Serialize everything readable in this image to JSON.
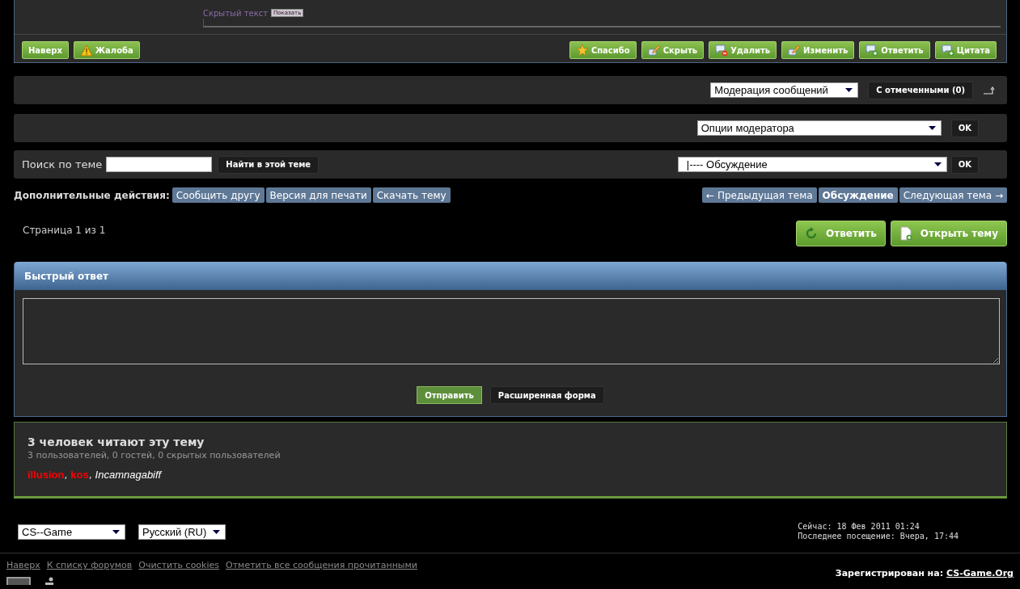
{
  "post": {
    "hidden_text": "Скрытый текст",
    "show_button": "Показать",
    "left_buttons": [
      {
        "label": "Наверх",
        "kind": "plain"
      },
      {
        "label": "Жалоба",
        "kind": "warning"
      }
    ],
    "right_buttons": [
      {
        "label": "Спасибо",
        "kind": "star"
      },
      {
        "label": "Скрыть",
        "kind": "pencil"
      },
      {
        "label": "Удалить",
        "kind": "remove"
      },
      {
        "label": "Изменить",
        "kind": "pencil"
      },
      {
        "label": "Ответить",
        "kind": "add"
      },
      {
        "label": "Цитата",
        "kind": "add"
      }
    ]
  },
  "moderation": {
    "select": "Модерация сообщений",
    "button": "С отмеченными (0)"
  },
  "mod_options": {
    "select": "Опции модератора",
    "button": "OK"
  },
  "search": {
    "label": "Поиск по теме",
    "button": "Найти в этой теме",
    "forum_select": "|---- Обсуждение",
    "go_button": "OK"
  },
  "extra_actions": {
    "label": "Дополнительные действия:",
    "links": [
      "Сообщить другу",
      "Версия для печати",
      "Скачать тему"
    ]
  },
  "topic_nav": [
    {
      "label": "← Предыдущая тема",
      "selected": false
    },
    {
      "label": "Обсуждение",
      "selected": true
    },
    {
      "label": "Следующая тема →",
      "selected": false
    }
  ],
  "pagination": "Страница 1 из 1",
  "topic_buttons": [
    {
      "label": "Ответить",
      "kind": "refresh"
    },
    {
      "label": "Открыть тему",
      "kind": "page"
    }
  ],
  "quick_reply": {
    "title": "Быстрый ответ",
    "send_button": "Отправить",
    "advanced_button": "Расширенная форма"
  },
  "readers": {
    "title": "3 человек читают эту тему",
    "summary": "3 пользователей, 0 гостей, 0 скрытых пользователей",
    "users": [
      {
        "name": "illusion",
        "separator": ",",
        "color": "#ff0000",
        "italic": false
      },
      {
        "name": "kos",
        "separator": ",",
        "color": "#ff0000",
        "italic": false
      },
      {
        "name": "Incamnagabiff",
        "color": "#ffffff",
        "italic": true
      }
    ]
  },
  "footer": {
    "skin_select": "CS--Game",
    "language_select": "Русский (RU)",
    "time_now": "Сейчас: 18 Фев 2011 01:24",
    "last_visit": "Последнее посещение: Вчера, 17:44",
    "links": [
      "Наверх",
      "К списку форумов",
      "Очистить cookies",
      "Отметить все сообщения прочитанными"
    ],
    "registered_label": "Зарегистрирован на:",
    "registered_link": "CS-Game.Org"
  }
}
